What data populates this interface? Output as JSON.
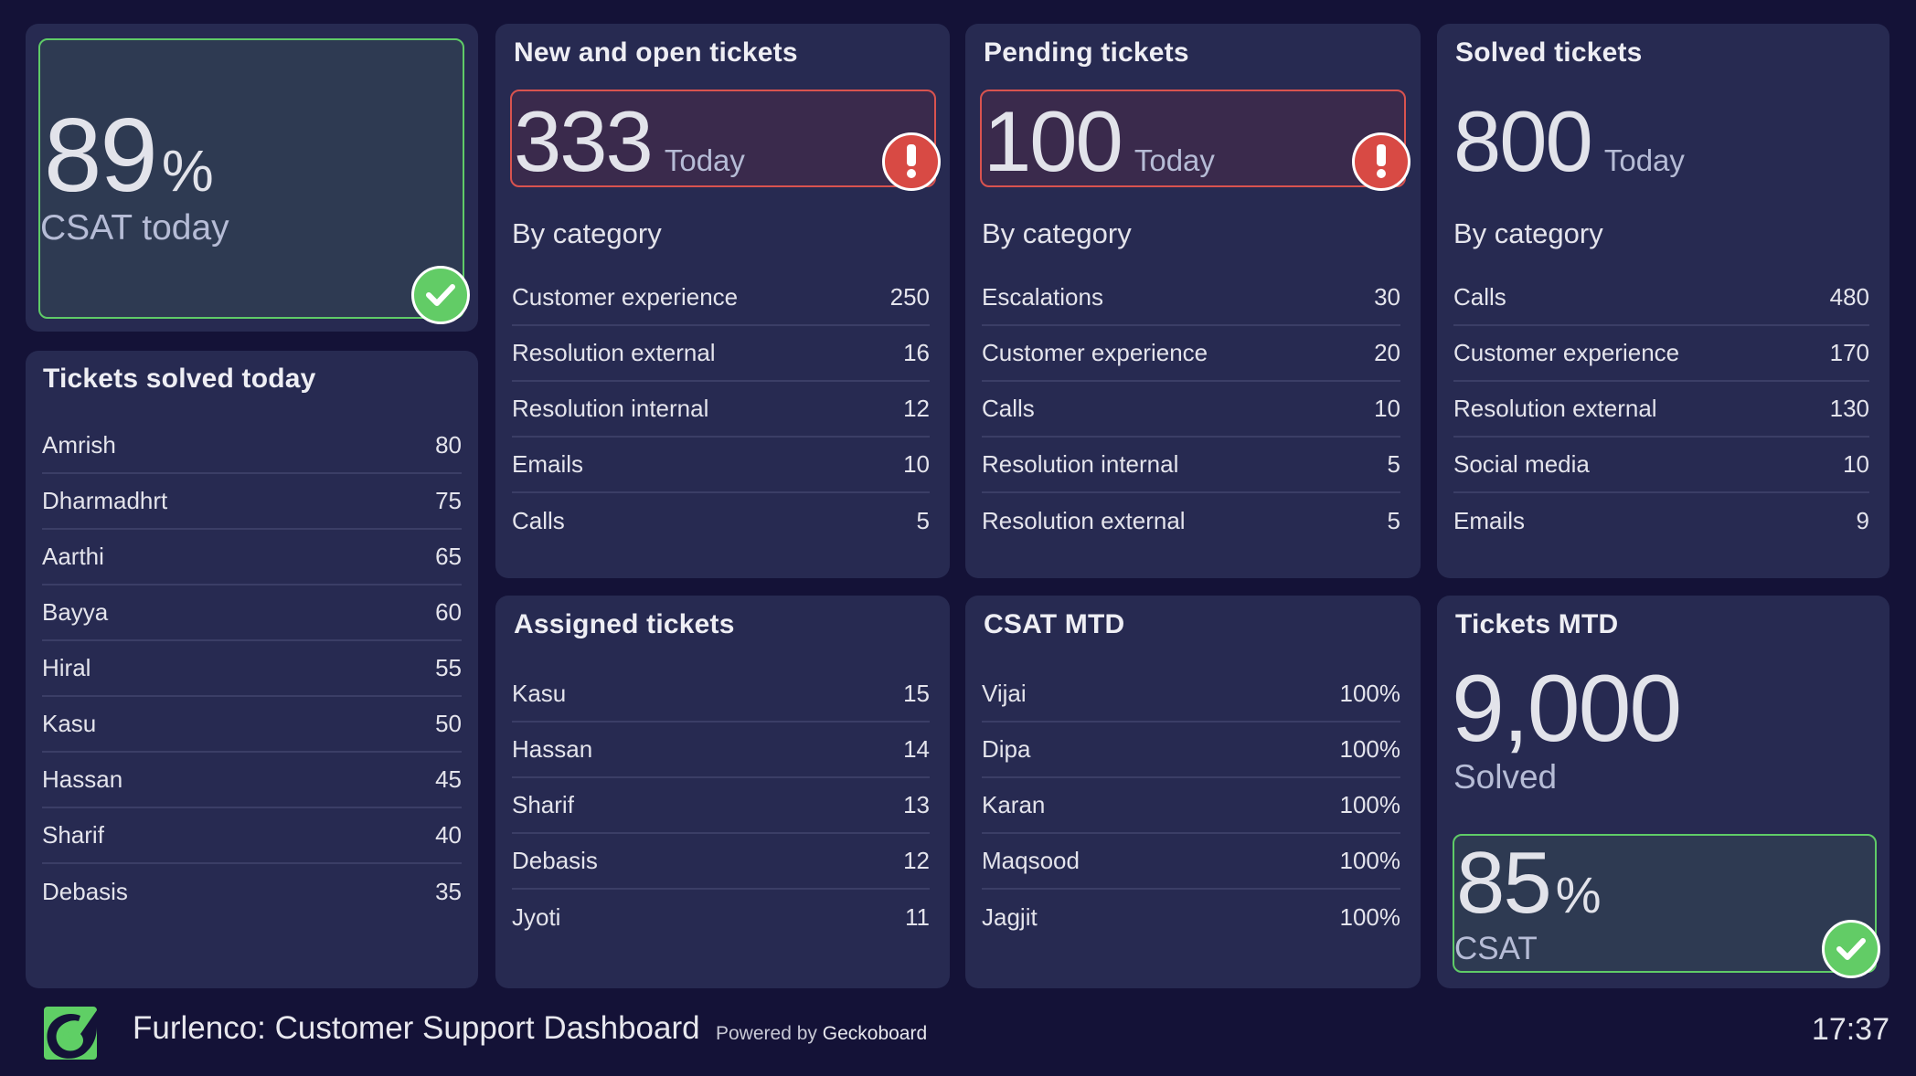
{
  "colors": {
    "background": "#141237",
    "card": "#272a51",
    "good": "#62cc66",
    "bad": "#d84a44"
  },
  "csat_today": {
    "value": "89",
    "unit": "%",
    "caption": "CSAT today",
    "status": "good",
    "status_icon": "check-icon"
  },
  "tickets_solved_today": {
    "title": "Tickets solved today",
    "rows": [
      {
        "label": "Amrish",
        "value": "80"
      },
      {
        "label": "Dharmadhrt",
        "value": "75"
      },
      {
        "label": "Aarthi",
        "value": "65"
      },
      {
        "label": "Bayya",
        "value": "60"
      },
      {
        "label": "Hiral",
        "value": "55"
      },
      {
        "label": "Kasu",
        "value": "50"
      },
      {
        "label": "Hassan",
        "value": "45"
      },
      {
        "label": "Sharif",
        "value": "40"
      },
      {
        "label": "Debasis",
        "value": "35"
      }
    ]
  },
  "new_open_tickets": {
    "title": "New and open tickets",
    "value": "333",
    "unit": "Today",
    "status": "bad",
    "status_icon": "alert-icon",
    "subtitle": "By category",
    "rows": [
      {
        "label": "Customer experience",
        "value": "250"
      },
      {
        "label": "Resolution external",
        "value": "16"
      },
      {
        "label": "Resolution internal",
        "value": "12"
      },
      {
        "label": "Emails",
        "value": "10"
      },
      {
        "label": "Calls",
        "value": "5"
      }
    ]
  },
  "pending_tickets": {
    "title": "Pending tickets",
    "value": "100",
    "unit": "Today",
    "status": "bad",
    "status_icon": "alert-icon",
    "subtitle": "By category",
    "rows": [
      {
        "label": "Escalations",
        "value": "30"
      },
      {
        "label": "Customer experience",
        "value": "20"
      },
      {
        "label": "Calls",
        "value": "10"
      },
      {
        "label": "Resolution internal",
        "value": "5"
      },
      {
        "label": "Resolution external",
        "value": "5"
      }
    ]
  },
  "solved_tickets": {
    "title": "Solved tickets",
    "value": "800",
    "unit": "Today",
    "subtitle": "By category",
    "rows": [
      {
        "label": "Calls",
        "value": "480"
      },
      {
        "label": "Customer experience",
        "value": "170"
      },
      {
        "label": "Resolution external",
        "value": "130"
      },
      {
        "label": "Social media",
        "value": "10"
      },
      {
        "label": "Emails",
        "value": "9"
      }
    ]
  },
  "assigned_tickets": {
    "title": "Assigned tickets",
    "rows": [
      {
        "label": "Kasu",
        "value": "15"
      },
      {
        "label": "Hassan",
        "value": "14"
      },
      {
        "label": "Sharif",
        "value": "13"
      },
      {
        "label": "Debasis",
        "value": "12"
      },
      {
        "label": "Jyoti",
        "value": "11"
      }
    ]
  },
  "csat_mtd": {
    "title": "CSAT MTD",
    "rows": [
      {
        "label": "Vijai",
        "value": "100%"
      },
      {
        "label": "Dipa",
        "value": "100%"
      },
      {
        "label": "Karan",
        "value": "100%"
      },
      {
        "label": "Maqsood",
        "value": "100%"
      },
      {
        "label": "Jagjit",
        "value": "100%"
      }
    ]
  },
  "tickets_mtd": {
    "title": "Tickets MTD",
    "value": "9,000",
    "caption": "Solved",
    "csat": {
      "value": "85",
      "unit": "%",
      "caption": "CSAT",
      "status": "good",
      "status_icon": "check-icon"
    }
  },
  "footer": {
    "logo": "furlenco-logo",
    "title": "Furlenco: Customer Support Dashboard",
    "powered_prefix": "Powered by",
    "powered_brand": "Geckoboard",
    "time": "17:37"
  }
}
